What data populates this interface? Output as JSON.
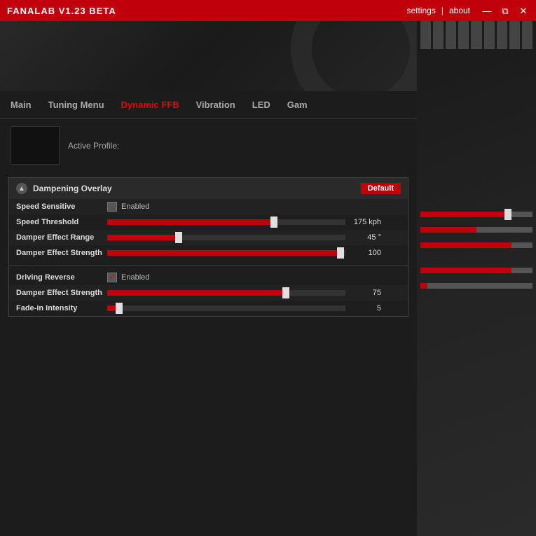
{
  "titleBar": {
    "title": "FANALAB V1.23 BETA",
    "links": [
      "settings",
      "|",
      "about"
    ],
    "controls": [
      "—",
      "⧉",
      "✕"
    ]
  },
  "nav": {
    "tabs": [
      {
        "label": "Main",
        "active": false
      },
      {
        "label": "Tuning Menu",
        "active": false
      },
      {
        "label": "Dynamic FFB",
        "active": true
      },
      {
        "label": "Vibration",
        "active": false
      },
      {
        "label": "LED",
        "active": false
      },
      {
        "label": "Gam",
        "active": false
      }
    ]
  },
  "profile": {
    "label": "Active Profile:"
  },
  "dampeningOverlay": {
    "title": "Dampening Overlay",
    "defaultBtn": "Default",
    "speedSensitive": {
      "label": "Speed Sensitive",
      "checkboxChecked": false,
      "controlLabel": "Enabled"
    },
    "speedThreshold": {
      "label": "Speed Threshold",
      "value": "175 kph",
      "fillPercent": 70
    },
    "damperEffectRange": {
      "label": "Damper Effect Range",
      "value": "45 °",
      "fillPercent": 30,
      "thumbPercent": 30
    },
    "damperEffectStrength1": {
      "label": "Damper Effect Strength",
      "value": "100",
      "fillPercent": 98
    }
  },
  "drivingReverse": {
    "label": "Driving Reverse",
    "checkboxChecked": true,
    "controlLabel": "Enabled",
    "damperEffectStrength": {
      "label": "Damper Effect Strength",
      "value": "75",
      "fillPercent": 75
    },
    "fadeInIntensity": {
      "label": "Fade-in Intensity",
      "value": "5",
      "fillPercent": 5
    }
  }
}
